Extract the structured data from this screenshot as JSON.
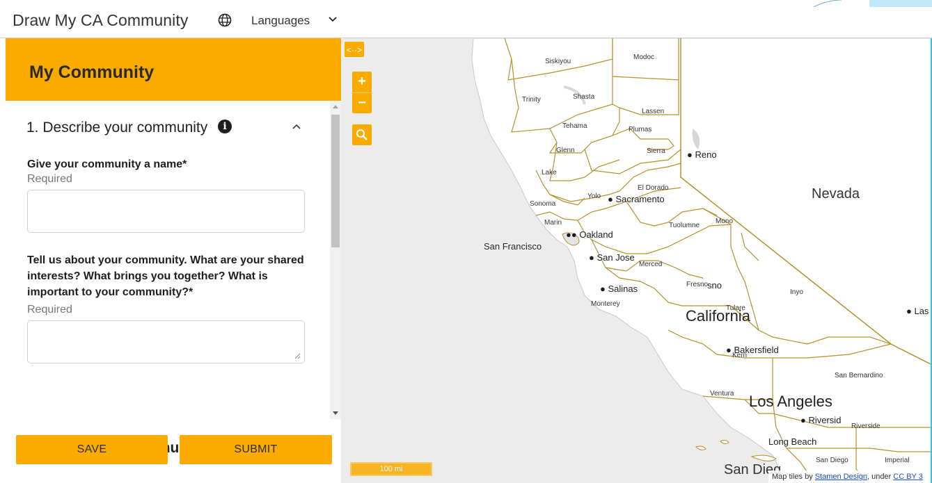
{
  "app": {
    "title": "Draw My CA Community",
    "languages_label": "Languages",
    "icons": {
      "language": "globe-icon",
      "languages_dropdown": "chevron-down-icon"
    }
  },
  "panel": {
    "title": "My Community",
    "section1": {
      "title": "1. Describe your community",
      "icons": {
        "info": "info-icon",
        "collapse": "chevron-up-icon"
      },
      "info_glyph": "i",
      "name_field": {
        "label": "Give your community a name*",
        "help": "Required",
        "value": ""
      },
      "about_field": {
        "label": "Tell us about your community. What are your shared interests? What brings you together? What is important to your community?*",
        "help": "Required",
        "value": ""
      }
    },
    "section3": {
      "title": "3. Submit your community",
      "save_label": "SAVE",
      "submit_label": "SUBMIT"
    }
  },
  "map": {
    "controls": {
      "swap_label": "<··>",
      "zoom_in_label": "+",
      "zoom_out_label": "−",
      "search_icon": "search-icon"
    },
    "scale_label": "100 mi",
    "attribution": {
      "prefix": "Map tiles by ",
      "link1": "Stamen Design",
      "mid": ", under ",
      "link2": "CC BY 3"
    },
    "labels": {
      "counties": {
        "siskiyou": "Siskiyou",
        "modoc": "Modoc",
        "trinity": "Trinity",
        "shasta": "Shasta",
        "lassen": "Lassen",
        "tehama": "Tehama",
        "plumas": "Plumas",
        "glenn": "Glenn",
        "sierra": "Sierra",
        "lake": "Lake",
        "el_dorado": "El Dorado",
        "yolo": "Yolo",
        "sonoma": "Sonoma",
        "marin": "Marin",
        "tuolumne": "Tuolumne",
        "mono": "Mono",
        "merced": "Merced",
        "fresno": "Fresno",
        "monterey": "Monterey",
        "inyo": "Inyo",
        "tulare": "Tulare",
        "kern": "Kern",
        "san_bernardino": "San Bernardino",
        "ventura": "Ventura",
        "riverside": "Riverside",
        "san_diego": "San Diego",
        "imperial": "Imperial"
      },
      "cities": {
        "reno": "Reno",
        "sacramento": "Sacramento",
        "oakland": "Oakland",
        "san_francisco": "San Francisco",
        "san_jose": "San Jose",
        "salinas": "Salinas",
        "fresno_city": "sno",
        "bakersfield": "Bakersfield",
        "riverside_city": "Riversid",
        "long_beach": "Long Beach",
        "san_diego_city": "San Dieg",
        "las_vegas": "Las"
      },
      "regions": {
        "nevada": "Nevada",
        "california": "California",
        "los_angeles": "Los Angeles"
      }
    }
  }
}
